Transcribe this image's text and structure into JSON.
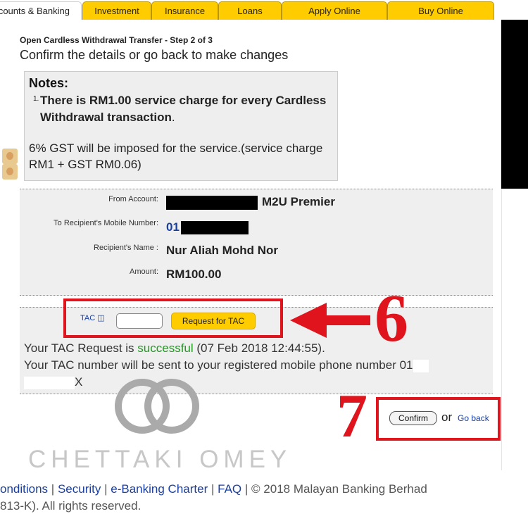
{
  "tabs": [
    {
      "label": "counts & Banking",
      "active": true
    },
    {
      "label": "Investment"
    },
    {
      "label": "Insurance"
    },
    {
      "label": "Loans"
    },
    {
      "label": "Apply Online"
    },
    {
      "label": "Buy Online"
    }
  ],
  "step_title": "Open Cardless Withdrawal Transfer - Step 2 of 3",
  "subtitle": "Confirm the details or go back to make changes",
  "notes": {
    "title": "Notes:",
    "item1_number": "1.",
    "item1_bold": "There is RM1.00 service charge for every Cardless Withdrawal transaction",
    "item1_tail": ".",
    "item2": "6% GST will be imposed for the service.(service charge RM1 + GST RM0.06)"
  },
  "details": {
    "from_account_label": "From Account:",
    "from_account_value": "M2U Premier",
    "recipient_mobile_label": "To Recipient's Mobile Number:",
    "recipient_mobile_value": "01",
    "recipient_name_label": "Recipient's Name :",
    "recipient_name_value": "Nur Aliah Mohd Nor",
    "amount_label": "Amount:",
    "amount_value": "RM100.00"
  },
  "tac": {
    "label": "TAC",
    "input_value": "",
    "request_button": "Request for TAC",
    "msg_prefix": "Your TAC Request is ",
    "msg_status": "successful",
    "msg_time": " (07 Feb 2018 12:44:55).",
    "msg_line2": "Your TAC number will be sent to your registered mobile phone number 01",
    "msg_line3_suffix": "X"
  },
  "annotations": {
    "step6": "6",
    "step7": "7"
  },
  "actions": {
    "confirm": "Confirm",
    "or": "or",
    "go_back": "Go back"
  },
  "watermark": "CHETTAKI OMEY",
  "footer": {
    "conditions": "onditions",
    "security": "Security",
    "charter": "e-Banking Charter",
    "faq": "FAQ",
    "copyright": "© 2018 Malayan Banking Berhad",
    "line2": "813-K). All rights reserved."
  },
  "colors": {
    "tab_yellow": "#ffcc00",
    "annotation_red": "#e0141c",
    "link_blue": "#1a3fa0",
    "success_green": "#1f9a1f"
  }
}
